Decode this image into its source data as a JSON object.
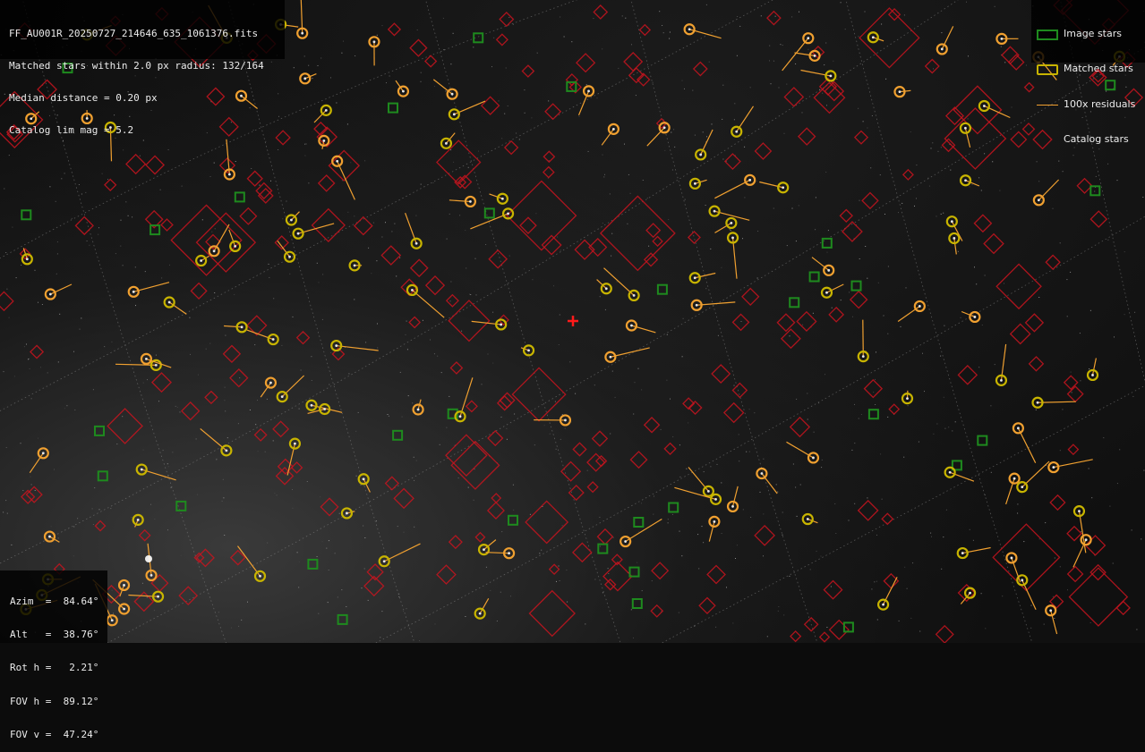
{
  "info": {
    "filename": "FF_AU001R_20250727_214646_635_1061376.fits",
    "matched_line": "Matched stars within 2.0 px radius: 132/164",
    "median_line": "Median distance = 0.20 px",
    "limmag_line": "Catalog lim mag = 5.2"
  },
  "legend": {
    "image_stars": "Image stars",
    "matched_stars": "Matched stars",
    "residuals": "100x residuals",
    "catalog_stars": "Catalog stars"
  },
  "pointing": {
    "azim": "Azim  =  84.64°",
    "alt": "Alt   =  38.76°",
    "rot": "Rot h =   2.21°",
    "fov_h": "FOV h =  89.12°",
    "fov_v": "FOV v =  47.24°"
  },
  "colors": {
    "image_star": "#1e8a1e",
    "matched_star": "#c8b400",
    "matched_star_fill": "#7a6a00",
    "residual": "#f0a030",
    "catalog_star": "#c8141e",
    "grid": "#8a8a8a",
    "center_marker": "#ff1a1a"
  }
}
